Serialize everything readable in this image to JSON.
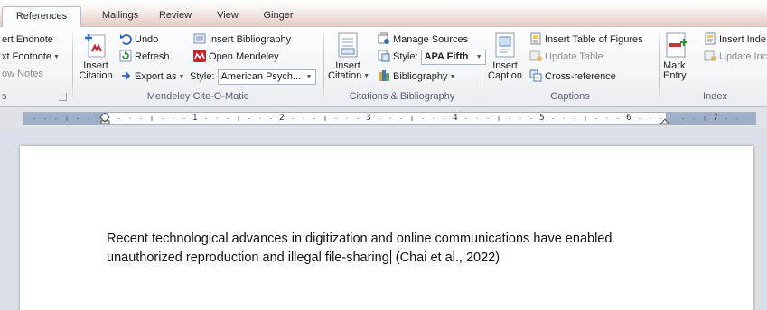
{
  "tabs": [
    {
      "label": "References",
      "active": true
    },
    {
      "label": "Mailings",
      "active": false
    },
    {
      "label": "Review",
      "active": false
    },
    {
      "label": "View",
      "active": false
    },
    {
      "label": "Ginger",
      "active": false
    }
  ],
  "footnotes_group": {
    "insert_endnote": "ert Endnote",
    "next_footnote": "xt Footnote",
    "show_notes": "ow Notes",
    "label": "s"
  },
  "mendeley": {
    "insert_citation": "Insert Citation",
    "undo": "Undo",
    "refresh": "Refresh",
    "export_as": "Export as",
    "insert_bibliography": "Insert Bibliography",
    "open_mendeley": "Open Mendeley",
    "style_label": "Style:",
    "style_value": "American Psych...",
    "label": "Mendeley Cite-O-Matic"
  },
  "citations": {
    "insert_citation": "Insert Citation",
    "manage_sources": "Manage Sources",
    "style_label": "Style:",
    "style_value": "APA Fifth",
    "bibliography": "Bibliography",
    "label": "Citations & Bibliography"
  },
  "captions": {
    "insert_caption": "Insert Caption",
    "insert_table_of_figures": "Insert Table of Figures",
    "update_table": "Update Table",
    "cross_reference": "Cross-reference",
    "label": "Captions"
  },
  "index": {
    "mark_entry": "Mark Entry",
    "insert_index": "Insert Inde",
    "update_index": "Update Inc",
    "label": "Index"
  },
  "ruler": {
    "numbers": [
      "1",
      "2",
      "3",
      "4",
      "5",
      "6",
      "7"
    ]
  },
  "document": {
    "line1": "Recent technological advances in digitization and online communications have enabled",
    "line2_before_cursor": "unauthorized reproduction and illegal file-sharing",
    "line2_after_cursor": " (Chai et al., 2022)"
  },
  "colors": {
    "accent_tab": "#e7c9c3",
    "ribbon": "#f3f5f8",
    "workspace": "#dbe0e7",
    "mendeley_red": "#c1272d"
  }
}
